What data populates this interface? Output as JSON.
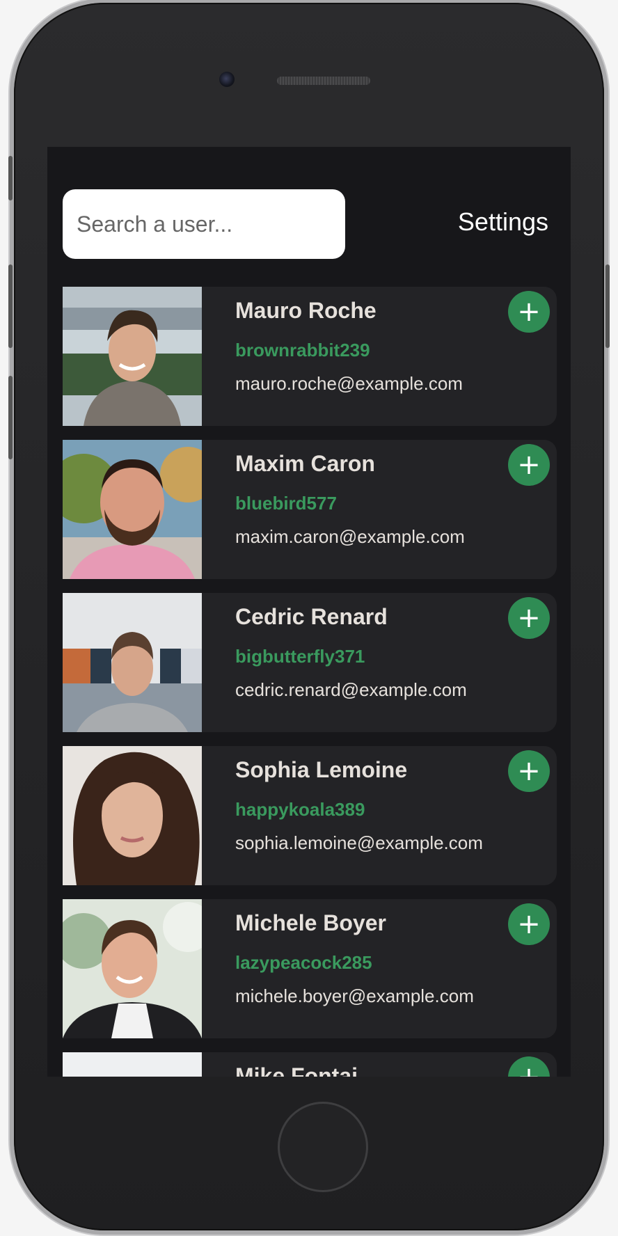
{
  "search": {
    "placeholder": "Search a user..."
  },
  "header": {
    "settings_label": "Settings"
  },
  "colors": {
    "accent": "#2f8c54",
    "username": "#3a9a5e",
    "card_bg": "#232326",
    "screen_bg": "#17171a"
  },
  "add_icon": "plus-icon",
  "users": [
    {
      "name": "Mauro Roche",
      "username": "brownrabbit239",
      "email": "mauro.roche@example.com"
    },
    {
      "name": "Maxim Caron",
      "username": "bluebird577",
      "email": "maxim.caron@example.com"
    },
    {
      "name": "Cedric Renard",
      "username": "bigbutterfly371",
      "email": "cedric.renard@example.com"
    },
    {
      "name": "Sophia Lemoine",
      "username": "happykoala389",
      "email": "sophia.lemoine@example.com"
    },
    {
      "name": "Michele Boyer",
      "username": "lazypeacock285",
      "email": "michele.boyer@example.com"
    },
    {
      "name": "Mike Fontai",
      "username": "",
      "email": ""
    }
  ]
}
